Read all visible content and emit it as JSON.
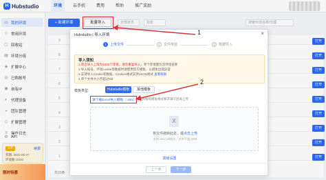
{
  "app": {
    "logo_text": "Hubstudio",
    "logo_letter": "H",
    "nav": [
      "环境",
      "云手机",
      "费用",
      "帮助",
      "推广奖励"
    ]
  },
  "sidebar": {
    "items": [
      {
        "label": "我的环境",
        "icon": "monitor-icon",
        "active": true
      },
      {
        "label": "常用环境",
        "icon": "star-icon"
      },
      {
        "label": "回收站",
        "icon": "trash-icon"
      },
      {
        "label": "环境分组",
        "icon": "folder-icon"
      },
      {
        "label": "扩展中心",
        "icon": "puzzle-icon"
      },
      {
        "label": "已购账号",
        "icon": "account-icon"
      },
      {
        "label": "自有IP",
        "icon": "ip-icon"
      },
      {
        "label": "代理设备",
        "icon": "proxy-icon"
      },
      {
        "label": "团队管理",
        "icon": "team-icon"
      },
      {
        "label": "扩展管理",
        "icon": "extension-icon"
      },
      {
        "label": "操作日志",
        "icon": "log-icon"
      },
      {
        "label": "API",
        "icon": "api-icon"
      }
    ],
    "vip": {
      "badge": "VIP",
      "renew": "续费",
      "line1": "到期: 2024-05-27",
      "line2": "环境数 10/20"
    },
    "promo": "限时特惠"
  },
  "toolbar": {
    "new_env": "+ 新建环境",
    "batch_import": "批量导入",
    "filter_status": "全部状态",
    "filter_tag": "标签",
    "filter_search": "搜索环境名称/代理"
  },
  "table": {
    "open_label": "打开",
    "row_numbers": [
      "9",
      "8",
      "7",
      "6",
      "5",
      "4",
      "3",
      "2",
      "1"
    ],
    "footer": "共20条"
  },
  "modal": {
    "title": "Hubstudio | 导入环境",
    "close": "×",
    "steps": [
      {
        "num": "1",
        "label": "上传文件"
      },
      {
        "num": "2",
        "label": "文件校验"
      },
      {
        "num": "3",
        "label": "数据导入"
      }
    ],
    "notice": {
      "title": "导入须知",
      "line1_red": "1.单次导入上限为1000个环境，请勿重复导入",
      "line1_rest": "，单个环境需包含环境名称",
      "line2": "2.导入账号、环境cookie等数据时请使用官方模板，以避免出现异常",
      "line3_a": "3.支持导入Cookie等数据，Cookies格式支持JSON格式",
      "line3_link": "查看帮助",
      "line4": "4.单个文件大小不超过5M"
    },
    "template_label": "模板类型:",
    "template_hub": "Hubstudio模板",
    "template_other": "其他模板",
    "download_link": "请下载Excel导入模板（.xlsx）",
    "download_hint": "，并按照模板格式要求填写后再上传",
    "drop_text_a": "将文件拖到此处，或",
    "drop_text_link": "点击上传",
    "drop_sub": "支持.xlsx/.xls格式，文件不超过5M",
    "advanced": "高级设置",
    "prev": "上一步",
    "next": "下一步"
  },
  "annotations": [
    "1",
    "2"
  ]
}
